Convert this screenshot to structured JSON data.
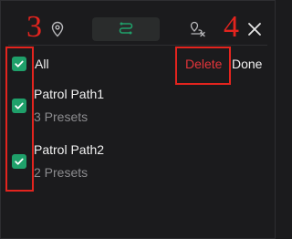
{
  "header": {
    "tabs": [
      {
        "name": "location",
        "icon": "location-pin-icon"
      },
      {
        "name": "path",
        "icon": "path-icon",
        "active": true
      },
      {
        "name": "route",
        "icon": "route-icon"
      }
    ],
    "close_icon": "close-icon"
  },
  "list": {
    "all_label": "All",
    "items": [
      {
        "name": "Patrol Path1",
        "presets": "3 Presets",
        "checked": true
      },
      {
        "name": "Patrol Path2",
        "presets": "2 Presets",
        "checked": true
      }
    ]
  },
  "actions": {
    "delete_label": "Delete",
    "done_label": "Done"
  },
  "annotations": {
    "checkbox_marker": "3",
    "delete_marker": "4"
  },
  "colors": {
    "background": "#1b1b1d",
    "checkbox": "#1fa06a",
    "delete": "#e5343a",
    "annotation": "#e3241e",
    "active_tab_icon": "#1fa06a"
  }
}
